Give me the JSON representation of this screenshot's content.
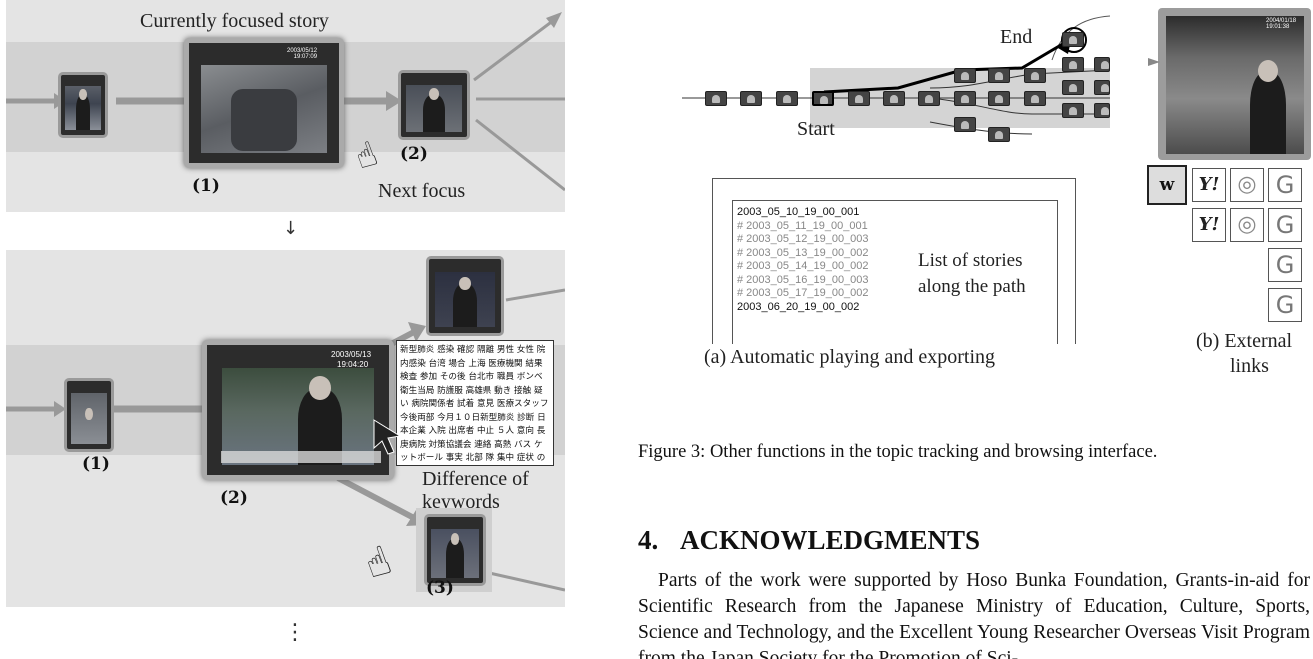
{
  "top_panel": {
    "caption_focused": "Currently focused story",
    "focused_time": "2003/05/12\n19:07:09",
    "label_1": "(1)",
    "label_2": "(2)",
    "caption_next": "Next focus",
    "arrow_down": "↓"
  },
  "bottom_panel": {
    "focused_time_date": "2003/05/13",
    "focused_time_clock": "19:04:20",
    "label_1": "(1)",
    "label_2": "(2)",
    "label_3": "(3)",
    "caption_diff": "Difference of keywords",
    "vertical_ellipsis": "⋮",
    "keywords": "新型肺炎 感染 確認 隔離 男性 女性 院内感染 台湾 場合 上海 医療機関 結果 検査 参加 その後 台北市 職員 ボンベ 衛生当局 防護服 高雄県 動き 接触 疑い 病院関係者 試着 意見 医療スタッフ 今後両部 今月１０日新型肺炎 診断 日本企業 入院 出席者 中止 ５人 意向 長庚病院 対策協議会 連絡 高熱 バス ケットボール 事実 北部 隊 集中 症状 の 感染経路 中国本土 増加 対象 可能"
  },
  "figure_a": {
    "label_end": "End",
    "label_start": "Start",
    "stories": [
      "2003_05_10_19_00_001",
      "# 2003_05_11_19_00_001",
      "# 2003_05_12_19_00_003",
      "# 2003_05_13_19_00_002",
      "# 2003_05_14_19_00_002",
      "# 2003_05_16_19_00_003",
      "# 2003_05_17_19_00_002",
      "2003_06_20_19_00_002"
    ],
    "list_caption_line1": "List of stories",
    "list_caption_line2": "along the path",
    "subcaption": "(a) Automatic playing and exporting"
  },
  "figure_b": {
    "thumb_time": "2004/01/18\n19:01:38",
    "subcaption_line1": "(b) External",
    "subcaption_line2": "links",
    "google_glyph": "G",
    "yahoo_glyph": "Y!"
  },
  "figure_caption": "Figure 3: Other functions in the topic tracking and browsing interface.",
  "section": {
    "number": "4.",
    "title": "ACKNOWLEDGMENTS",
    "body": "Parts of the work were supported by Hoso Bunka Foundation, Grants-in-aid for Scientific Research from the Japanese Ministry of Education, Culture, Sports, Science and Technology, and the Excellent Young Researcher Overseas Visit Program from the Japan Society for the Promotion of Sci-"
  }
}
